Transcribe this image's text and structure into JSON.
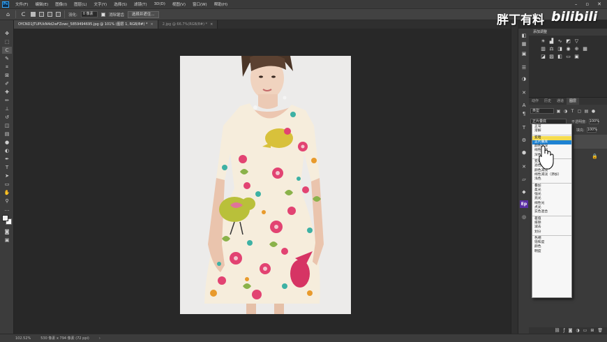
{
  "menubar": {
    "logo": "Ps",
    "items": [
      "文件(F)",
      "编辑(E)",
      "图像(I)",
      "图层(L)",
      "文字(Y)",
      "选择(S)",
      "滤镜(T)",
      "3D(D)",
      "视图(V)",
      "窗口(W)",
      "帮助(H)"
    ]
  },
  "options": {
    "feather_label": "羽化:",
    "feather_value": "0 像素",
    "antialias_label": "消除锯齿",
    "select_mask_button": "选择并遮住..."
  },
  "tabs": [
    {
      "label": "OYCND1JTUPUkN4d2wFZowc_5859494695.jpg @ 101% (图层 1, RGB/8#) *",
      "close": "×",
      "active": true
    },
    {
      "label": "2.jpg @ 66.7%(RGB/8#) *",
      "close": "×",
      "active": false
    }
  ],
  "status": {
    "zoom": "102.52%",
    "doc_info": "530 像素 x 794 像素 (72 ppi)",
    "arrow": "›"
  },
  "right_panel": {
    "adjustments_tab": "添加调整",
    "layer_tabs": [
      "动作",
      "历史",
      "通道",
      "图层"
    ],
    "filter_kind": "类型",
    "blend_mode": "正片叠底",
    "opacity_label": "不透明度:",
    "opacity_value": "100%",
    "fill_label": "填充:",
    "fill_value": "100%"
  },
  "blend_menu": {
    "groups": [
      [
        "正常",
        "溶解"
      ],
      [
        "变暗",
        "正片叠底",
        "颜色加深",
        "线性加深",
        "深色"
      ],
      [
        "变亮",
        "滤色",
        "颜色减淡",
        "线性减淡（添加）",
        "浅色"
      ],
      [
        "叠加",
        "柔光",
        "强光",
        "亮光",
        "线性光",
        "点光",
        "实色混合"
      ],
      [
        "差值",
        "排除",
        "减去",
        "划分"
      ],
      [
        "色相",
        "饱和度",
        "颜色",
        "明度"
      ]
    ],
    "highlighted": "正片叠底",
    "hovered": "变暗"
  },
  "watermark": {
    "text": "胖丁有料",
    "brand": "bilibili"
  },
  "colors": {
    "chrome_dark": "#282828",
    "panel": "#3a3a3a",
    "menu_highlight": "#1e82d2",
    "hover_yellow": "#f5dc4f",
    "photoshop_blue": "#31a8ff"
  }
}
